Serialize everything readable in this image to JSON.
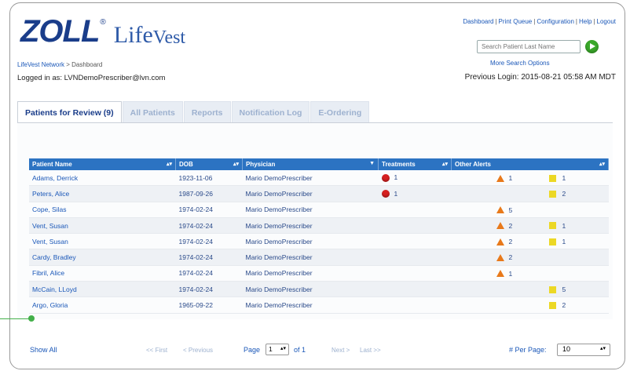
{
  "brand": {
    "zoll": "ZOLL",
    "life": "Life",
    "vest": "Vest",
    "registered": "®"
  },
  "breadcrumb": {
    "root": "LifeVest Network",
    "sep": " > ",
    "current": "Dashboard"
  },
  "logged_in": "Logged in as: LVNDemoPrescriber@lvn.com",
  "top_links": [
    "Dashboard",
    "Print Queue",
    "Configuration",
    "Help",
    "Logout"
  ],
  "search": {
    "placeholder": "Search Patient Last Name",
    "more": "More Search Options"
  },
  "previous_login": "Previous Login: 2015-08-21 05:58 AM MDT",
  "tabs": [
    "Patients for Review (9)",
    "All Patients",
    "Reports",
    "Notification Log",
    "E-Ordering"
  ],
  "table": {
    "headers": [
      "Patient Name",
      "DOB",
      "Physician",
      "Treatments",
      "Other Alerts"
    ],
    "rows": [
      {
        "name": "Adams, Derrick",
        "dob": "1923-11-06",
        "physician": "Mario DemoPrescriber",
        "treatments": "1",
        "orange": "1",
        "yellow": "1"
      },
      {
        "name": "Peters, Alice",
        "dob": "1987-09-26",
        "physician": "Mario DemoPrescriber",
        "treatments": "1",
        "orange": "",
        "yellow": "2"
      },
      {
        "name": "Cope, Silas",
        "dob": "1974-02-24",
        "physician": "Mario DemoPrescriber",
        "treatments": "",
        "orange": "5",
        "yellow": ""
      },
      {
        "name": "Vent, Susan",
        "dob": "1974-02-24",
        "physician": "Mario DemoPrescriber",
        "treatments": "",
        "orange": "2",
        "yellow": "1"
      },
      {
        "name": "Vent, Susan",
        "dob": "1974-02-24",
        "physician": "Mario DemoPrescriber",
        "treatments": "",
        "orange": "2",
        "yellow": "1"
      },
      {
        "name": "Cardy, Bradley",
        "dob": "1974-02-24",
        "physician": "Mario DemoPrescriber",
        "treatments": "",
        "orange": "2",
        "yellow": ""
      },
      {
        "name": "Fibril, Alice",
        "dob": "1974-02-24",
        "physician": "Mario DemoPrescriber",
        "treatments": "",
        "orange": "1",
        "yellow": ""
      },
      {
        "name": "McCain, LLoyd",
        "dob": "1974-02-24",
        "physician": "Mario DemoPrescriber",
        "treatments": "",
        "orange": "",
        "yellow": "5"
      },
      {
        "name": "Argo, Gloria",
        "dob": "1965-09-22",
        "physician": "Mario DemoPrescriber",
        "treatments": "",
        "orange": "",
        "yellow": "2"
      }
    ]
  },
  "footer": {
    "show_all": "Show All",
    "first": "<< First",
    "previous": "< Previous",
    "page_label": "Page",
    "page_value": "1",
    "of_label": "of 1",
    "next": "Next >",
    "last": "Last >>",
    "per_page_label": "# Per Page:",
    "per_page_value": "10"
  },
  "colors": {
    "brand_blue": "#1a3d8a",
    "header_blue": "#2c73c2",
    "treatment_red": "#d62020",
    "alert_orange": "#e8791a",
    "alert_yellow": "#ecd825",
    "go_green": "#3aa82a"
  }
}
